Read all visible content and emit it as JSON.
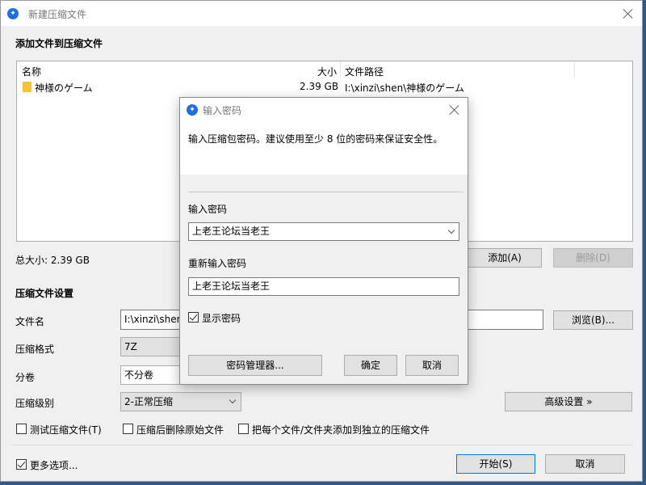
{
  "main": {
    "title": "新建压缩文件",
    "section_files": "添加文件到压缩文件",
    "columns": {
      "name": "名称",
      "size": "大小",
      "path": "文件路径"
    },
    "files": [
      {
        "name": "神様のゲーム",
        "size": "2.39 GB",
        "path": "I:\\xinzi\\shen\\神様のゲーム"
      }
    ],
    "total_size": "总大小: 2.39 GB",
    "add_button": "添加(A)",
    "delete_button": "删除(D)",
    "section_settings": "压缩文件设置",
    "filename_label": "文件名",
    "filename_value": "I:\\xinzi\\shen",
    "browse_button": "浏览(B)...",
    "format_label": "压缩格式",
    "format_value": "7Z",
    "volume_label": "分卷",
    "volume_value": "不分卷",
    "level_label": "压缩级别",
    "level_value": "2-正常压缩",
    "advanced_button": "高级设置 »",
    "test_checkbox": "测试压缩文件(T)",
    "delete_after_checkbox": "压缩后删除原始文件",
    "each_separate_checkbox": "把每个文件/文件夹添加到独立的压缩文件",
    "more_options": "更多选项...",
    "start_button": "开始(S)",
    "cancel_button": "取消"
  },
  "dialog": {
    "title": "输入密码",
    "description": "输入压缩包密码。建议使用至少 8 位的密码来保证安全性。",
    "password_label": "输入密码",
    "password_value": "上老王论坛当老王",
    "reenter_label": "重新输入密码",
    "reenter_value": "上老王论坛当老王",
    "show_password": "显示密码",
    "manager_button": "密码管理器...",
    "ok_button": "确定",
    "cancel_button": "取消"
  }
}
